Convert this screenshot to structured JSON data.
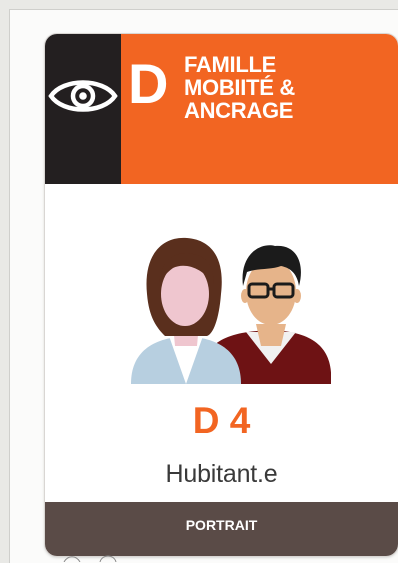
{
  "card": {
    "letter": "D",
    "family_lines": [
      "FAMILLE",
      "MOBIITÉ &",
      "ANCRAGE"
    ],
    "code": "D 4",
    "name": "Hubitant.e",
    "footer": "PORTRAIT",
    "icon": "eye-icon",
    "illustration": "man-and-woman-portrait-illustration"
  },
  "colors": {
    "orange": "#f26522",
    "dark": "#231f20",
    "footer": "#5a4b47"
  }
}
